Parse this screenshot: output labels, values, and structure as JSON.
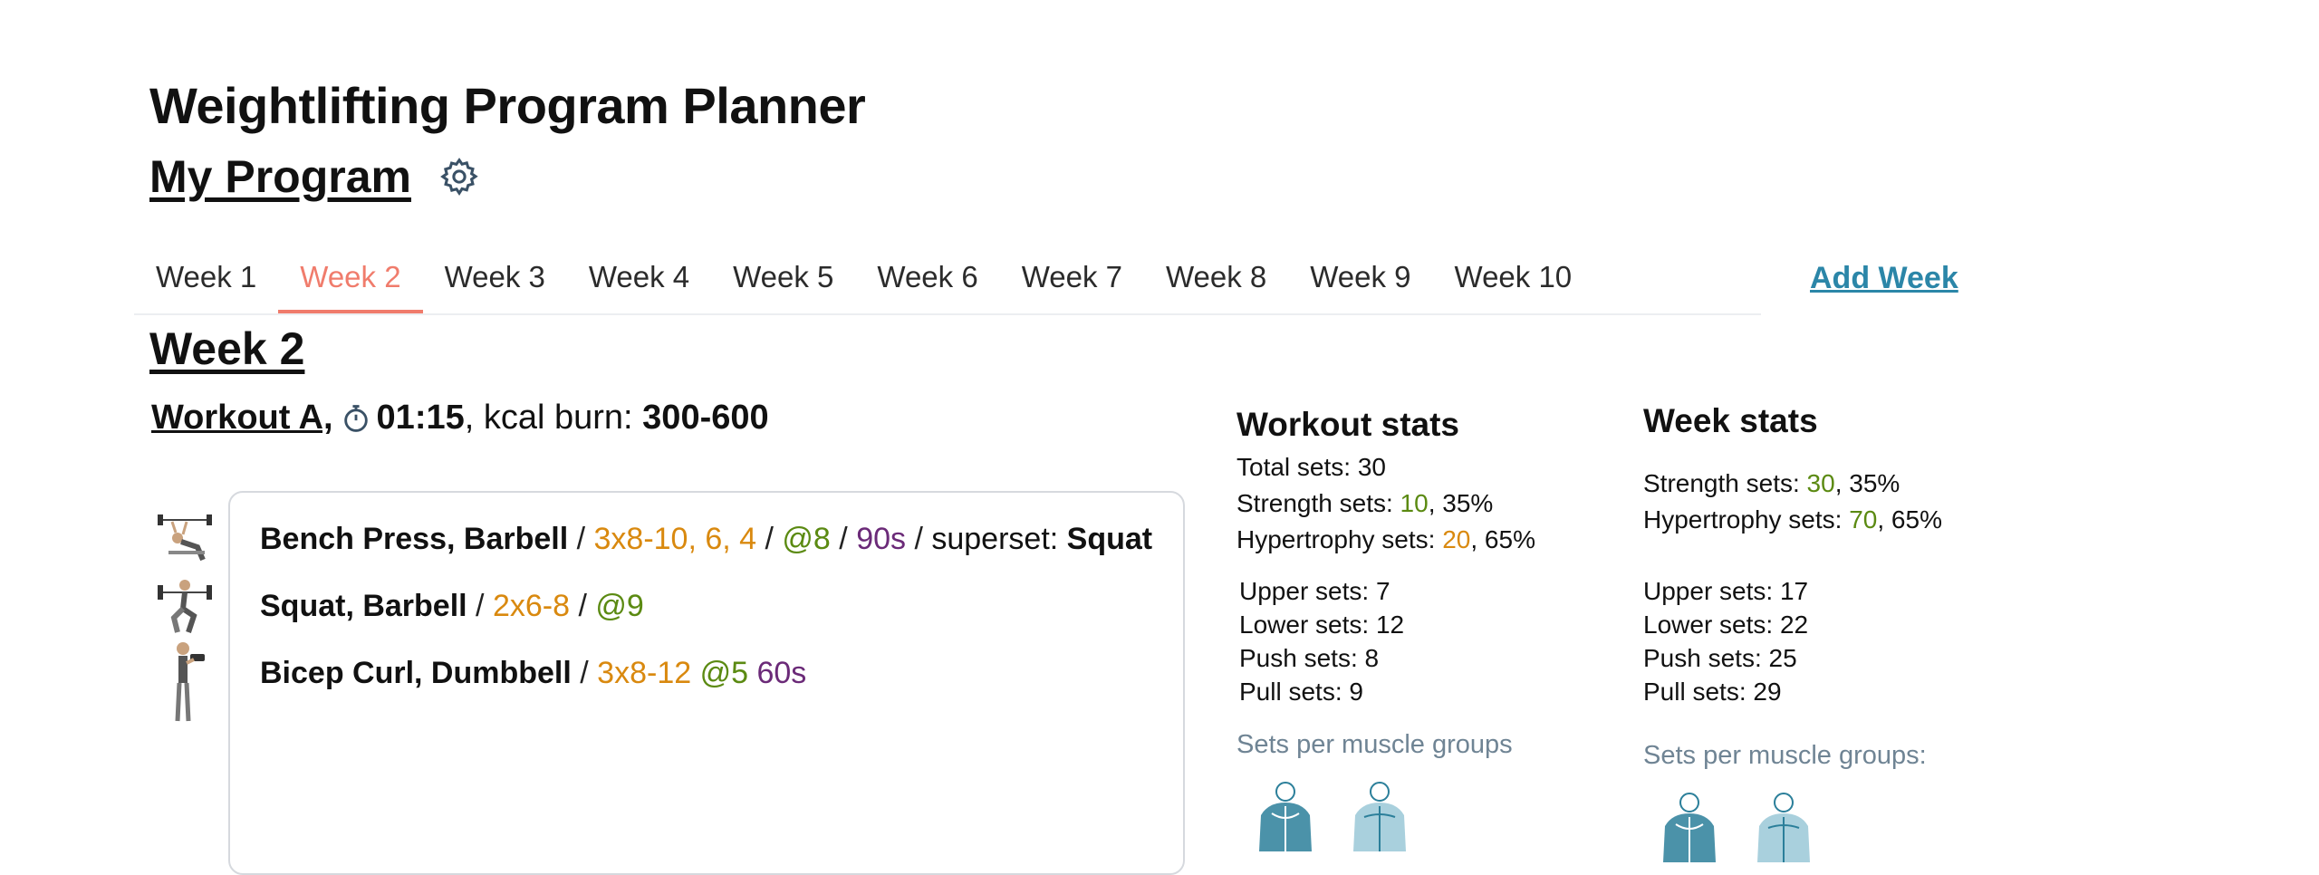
{
  "app": {
    "title": "Weightlifting Program Planner"
  },
  "program": {
    "title": "My Program",
    "settings_icon": "gear-icon"
  },
  "tabs": [
    {
      "label": "Week 1",
      "active": false
    },
    {
      "label": "Week 2",
      "active": true
    },
    {
      "label": "Week 3",
      "active": false
    },
    {
      "label": "Week 4",
      "active": false
    },
    {
      "label": "Week 5",
      "active": false
    },
    {
      "label": "Week 6",
      "active": false
    },
    {
      "label": "Week 7",
      "active": false
    },
    {
      "label": "Week 8",
      "active": false
    },
    {
      "label": "Week 9",
      "active": false
    },
    {
      "label": "Week 10",
      "active": false
    }
  ],
  "add_week_label": "Add Week",
  "week": {
    "title": "Week 2"
  },
  "workout": {
    "name": "Workout A,",
    "timer_icon": "stopwatch-icon",
    "duration": "01:15",
    "kcal_label": ", kcal burn: ",
    "kcal_value": "300-600"
  },
  "exercises": [
    {
      "name": "Bench Press, Barbell",
      "sets": "3x8-10, 6, 4",
      "rpe": "@8",
      "rest": "90s",
      "superset_label": "superset: ",
      "superset": "Squat",
      "thumb_icon": "bench-press-icon"
    },
    {
      "name": "Squat, Barbell",
      "sets": "2x6-8",
      "rpe": "@9",
      "thumb_icon": "squat-icon"
    },
    {
      "name": "Bicep Curl, Dumbbell",
      "sets": "3x8-12",
      "rpe": "@5",
      "rest": "60s",
      "thumb_icon": "bicep-curl-icon"
    }
  ],
  "separator": " / ",
  "workout_stats": {
    "title": "Workout stats",
    "total_label": "Total sets: 30",
    "strength_label": "Strength sets: ",
    "strength_value": "10",
    "strength_pct": ", 35%",
    "hyper_label": "Hypertrophy sets: ",
    "hyper_value": "20",
    "hyper_pct": ", 65%",
    "upper": "Upper sets: 7",
    "lower": "Lower sets: 12",
    "push": "Push sets: 8",
    "pull": "Pull sets: 9",
    "muscle_label": "Sets per muscle groups"
  },
  "week_stats": {
    "title": "Week stats",
    "strength_label": "Strength sets: ",
    "strength_value": "30",
    "strength_pct": ", 35%",
    "hyper_label": "Hypertrophy sets: ",
    "hyper_value": "70",
    "hyper_pct": ", 65%",
    "upper": "Upper sets: 17",
    "lower": "Lower sets: 22",
    "push": "Push sets: 25",
    "pull": "Pull sets: 29",
    "muscle_label": "Sets per muscle groups:"
  },
  "colors": {
    "accent": "#f07c6c",
    "link": "#2b86a8",
    "sets": "#d9890f",
    "rpe": "#5b8a12",
    "rest": "#6b2a78",
    "muscle": "#2b7f9a"
  }
}
